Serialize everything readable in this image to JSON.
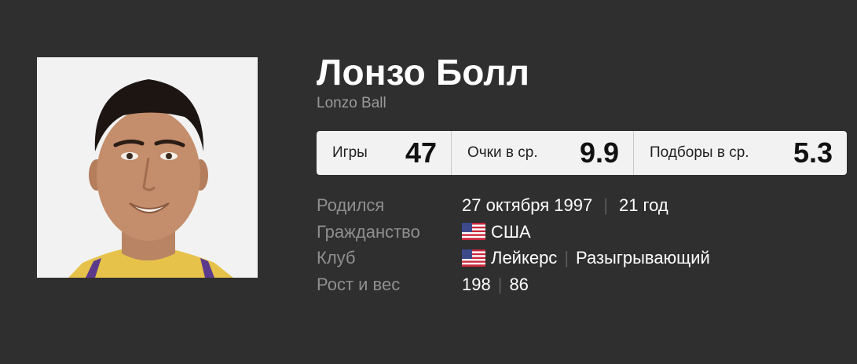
{
  "player": {
    "name": "Лонзо Болл",
    "name_latin": "Lonzo Ball"
  },
  "stats": [
    {
      "label": "Игры",
      "value": "47"
    },
    {
      "label": "Очки в ср.",
      "value": "9.9"
    },
    {
      "label": "Подборы в ср.",
      "value": "5.3"
    }
  ],
  "details": {
    "born_label": "Родился",
    "born_date": "27 октября 1997",
    "age": "21 год",
    "citizenship_label": "Гражданство",
    "citizenship": "США",
    "citizenship_flag": "us-flag-icon",
    "club_label": "Клуб",
    "club": "Лейкерс",
    "club_flag": "us-flag-icon",
    "position": "Разыгрывающий",
    "height_weight_label": "Рост и вес",
    "height": "198",
    "weight": "86"
  },
  "colors": {
    "background": "#2f2f2f",
    "stats_bar": "#f2f2f2",
    "label_gray": "#8f8f8f",
    "subtitle_gray": "#9a9a9a"
  }
}
